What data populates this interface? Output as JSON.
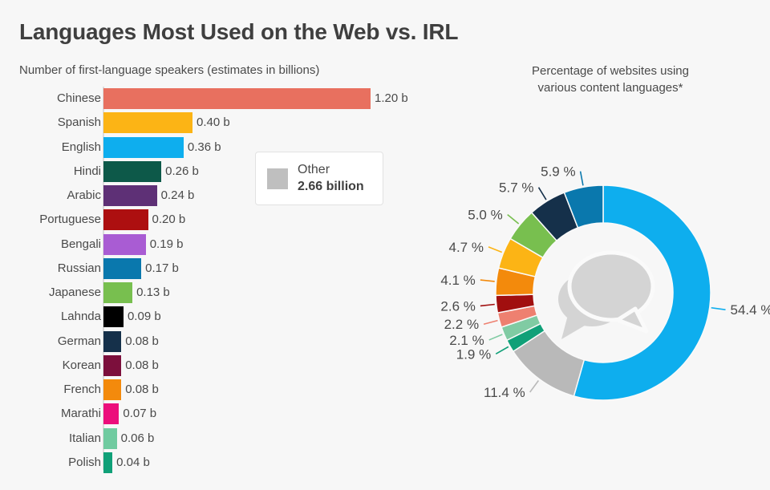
{
  "header": {
    "title": "Languages Most Used on the Web vs. IRL",
    "left_subtitle": "Number of first-language speakers (estimates in billions)",
    "right_subtitle_line1": "Percentage of websites using",
    "right_subtitle_line2": "various content languages*"
  },
  "legend": {
    "label": "Other",
    "value": "2.66 billion",
    "swatch_color": "#bfbfbf"
  },
  "chart_data": [
    {
      "type": "bar",
      "orientation": "horizontal",
      "title": "Number of first-language speakers (estimates in billions)",
      "xlabel": "",
      "ylabel": "",
      "unit": "b",
      "xlim": [
        0,
        1.2
      ],
      "grid": false,
      "categories": [
        "Chinese",
        "Spanish",
        "English",
        "Hindi",
        "Arabic",
        "Portuguese",
        "Bengali",
        "Russian",
        "Japanese",
        "Lahnda",
        "German",
        "Korean",
        "French",
        "Marathi",
        "Italian",
        "Polish"
      ],
      "values": [
        1.2,
        0.4,
        0.36,
        0.26,
        0.24,
        0.2,
        0.19,
        0.17,
        0.13,
        0.09,
        0.08,
        0.08,
        0.08,
        0.07,
        0.06,
        0.04
      ],
      "value_labels": [
        "1.20 b",
        "0.40 b",
        "0.36 b",
        "0.26 b",
        "0.24 b",
        "0.20 b",
        "0.19 b",
        "0.17 b",
        "0.13 b",
        "0.09 b",
        "0.08 b",
        "0.08 b",
        "0.08 b",
        "0.07 b",
        "0.06 b",
        "0.04 b"
      ],
      "colors": [
        "#e8705f",
        "#fcb415",
        "#0eaeee",
        "#0d5949",
        "#5e3076",
        "#ad0f10",
        "#a95cd3",
        "#0a78ad",
        "#78bf4f",
        "#000000",
        "#15304a",
        "#7c0f3c",
        "#f38a0c",
        "#ec0e7b",
        "#70cba0",
        "#10a078"
      ]
    },
    {
      "type": "pie",
      "variant": "donut",
      "title": "Percentage of websites using various content languages*",
      "unit": "%",
      "start_angle_deg": 0,
      "direction": "clockwise",
      "values": [
        54.4,
        11.4,
        1.9,
        2.1,
        2.2,
        2.6,
        4.1,
        4.7,
        5.0,
        5.7,
        5.9
      ],
      "value_labels": [
        "54.4 %",
        "11.4 %",
        "1.9 %",
        "2.1 %",
        "2.2 %",
        "2.6 %",
        "4.1 %",
        "4.7 %",
        "5.0 %",
        "5.7 %",
        "5.9 %"
      ],
      "colors": [
        "#0eaeee",
        "#b9b9b9",
        "#10a078",
        "#80cba3",
        "#ee8070",
        "#a10f0f",
        "#f38a0c",
        "#fcb415",
        "#78bf4f",
        "#15304a",
        "#0a78ad"
      ],
      "center_icon": "speech-bubbles-icon"
    }
  ]
}
